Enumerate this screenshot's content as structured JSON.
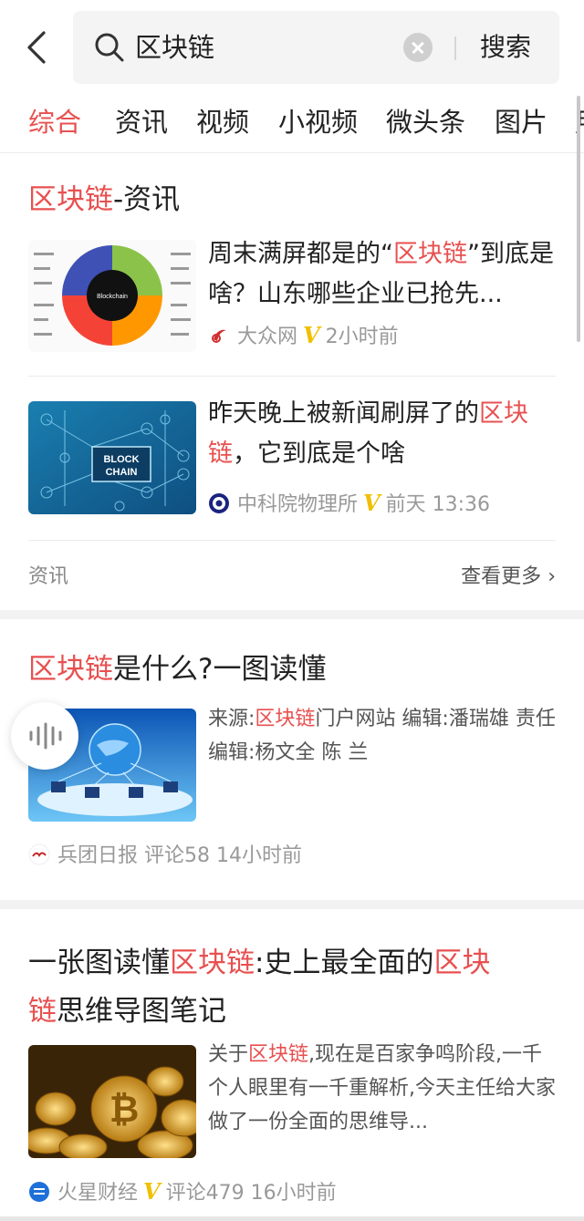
{
  "search": {
    "query": "区块链",
    "button": "搜索"
  },
  "tabs": [
    "综合",
    "资讯",
    "视频",
    "小视频",
    "微头条",
    "图片",
    "用"
  ],
  "news_section": {
    "title_hl": "区块链",
    "title_rest": "-资讯",
    "items": [
      {
        "title_parts": [
          "周末满屏都是的“",
          "区块链",
          "”到底是啥？山东哪些企业已抢先..."
        ],
        "source": "大众网",
        "verified": "V",
        "time": "2小时前",
        "thumb_caption": "Blockchain"
      },
      {
        "title_parts": [
          "昨天晚上被新闻刷屏了的",
          "区块链",
          "，它到底是个啥"
        ],
        "source": "中科院物理所",
        "verified": "V",
        "time": "前天 13:36",
        "thumb_caption": "BLOCK CHAIN"
      }
    ],
    "footer_label": "资讯",
    "more_label": "查看更多"
  },
  "article1": {
    "title_hl": "区块链",
    "title_rest": "是什么?一图读懂",
    "desc_parts": [
      "来源:",
      "区块链",
      "门户网站 编辑:潘瑞雄 责任编辑:杨文全 陈 兰"
    ],
    "source": "兵团日报",
    "comments": "评论58",
    "time": "14小时前"
  },
  "article2": {
    "title_parts": [
      "一张图读懂",
      "区块链",
      ":史上最全面的",
      "区块",
      "链",
      "思维导图笔记"
    ],
    "desc_parts": [
      "关于",
      "区块链",
      ",现在是百家争鸣阶段,一千个人眼里有一千重解析,今天主任给大家做了一份全面的思维导..."
    ],
    "source": "火星财经",
    "verified": "V",
    "comments": "评论479",
    "time": "16小时前"
  },
  "colors": {
    "highlight": "#e85050",
    "verified": "#f0c000",
    "muted": "#999999"
  }
}
